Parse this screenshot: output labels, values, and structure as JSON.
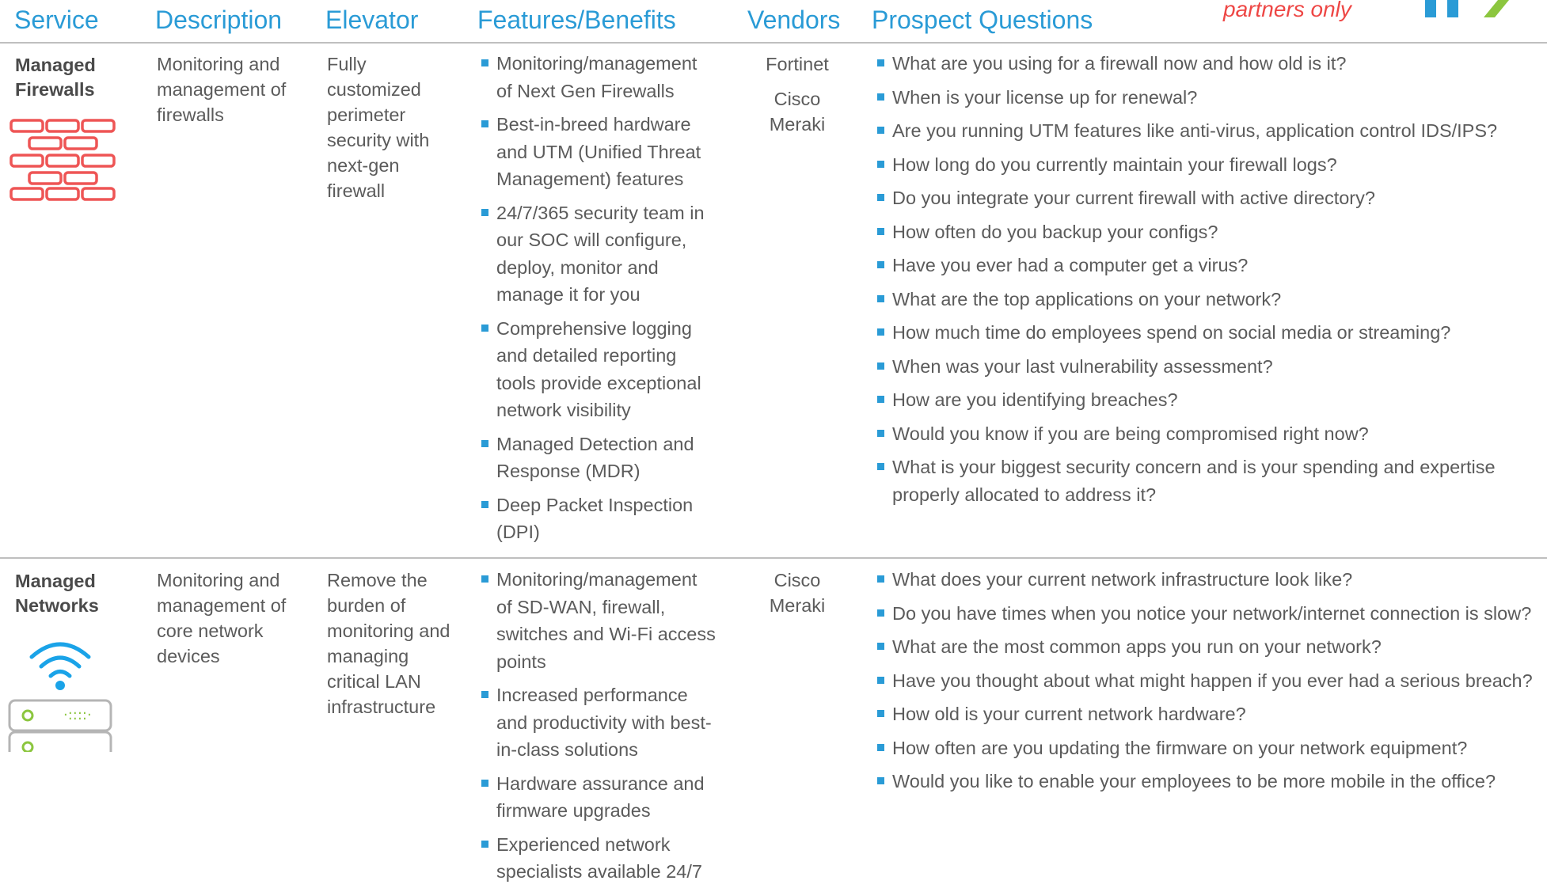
{
  "header": {
    "service": "Service",
    "description": "Description",
    "elevator": "Elevator",
    "features": "Features/Benefits",
    "vendors": "Vendors",
    "questions": "Prospect Questions",
    "tagline": "partners only"
  },
  "colors": {
    "accent": "#2a9bd6",
    "tagline": "#ee4745",
    "firewall_icon": "#ee5555",
    "wifi_icon": "#1aa3e8",
    "led": "#8cc63f",
    "logo_green": "#8cc63f"
  },
  "rows": [
    {
      "service": "Managed Firewalls",
      "icon": "brick-wall-icon",
      "description": "Monitoring and management of firewalls",
      "elevator": "Fully customized perimeter security with next-gen firewall",
      "features": [
        "Monitoring/management of Next Gen Firewalls",
        "Best-in-breed hardware and UTM (Unified Threat Management) features",
        "24/7/365 security team in our SOC will configure, deploy, monitor and manage it for you",
        "Comprehensive logging and detailed reporting tools provide exceptional network visibility",
        "Managed Detection and Response (MDR)",
        "Deep Packet Inspection (DPI)"
      ],
      "vendors": [
        "Fortinet",
        "Cisco Meraki"
      ],
      "questions": [
        "What are you using for a firewall now and how old is it?",
        "When is your license up for renewal?",
        "Are you running UTM features like anti-virus, application control IDS/IPS?",
        "How long do you currently maintain your firewall logs?",
        "Do you integrate your current firewall with active directory?",
        "How often do you backup your configs?",
        "Have you ever had a computer get a virus?",
        "What are the top applications on your network?",
        "How much time do employees spend on social media or streaming?",
        "When was your last vulnerability assessment?",
        "How are you identifying breaches?",
        "Would you know if you are being compromised right now?",
        "What is your biggest security concern and is your spending and expertise properly allocated to address it?"
      ]
    },
    {
      "service": "Managed Networks",
      "icon": "wifi-router-icon",
      "description": "Monitoring and management of core network devices",
      "elevator": "Remove the burden of monitoring and managing critical LAN infrastructure",
      "features": [
        "Monitoring/management of SD-WAN, firewall, switches and Wi-Fi access points",
        "Increased performance and productivity with best-in-class solutions",
        "Hardware assurance and firmware upgrades",
        "Experienced network specialists available 24/7"
      ],
      "vendors": [
        "Cisco Meraki"
      ],
      "questions": [
        "What does your current network infrastructure look like?",
        "Do you have times when you notice your network/internet connection is slow?",
        "What are the most common apps you run on your network?",
        "Have you thought about what might happen if you ever had a serious breach?",
        "How old is your current network hardware?",
        "How often are you updating the firmware on your network equipment?",
        "Would you like to enable your employees to be more mobile in the office?"
      ]
    }
  ]
}
